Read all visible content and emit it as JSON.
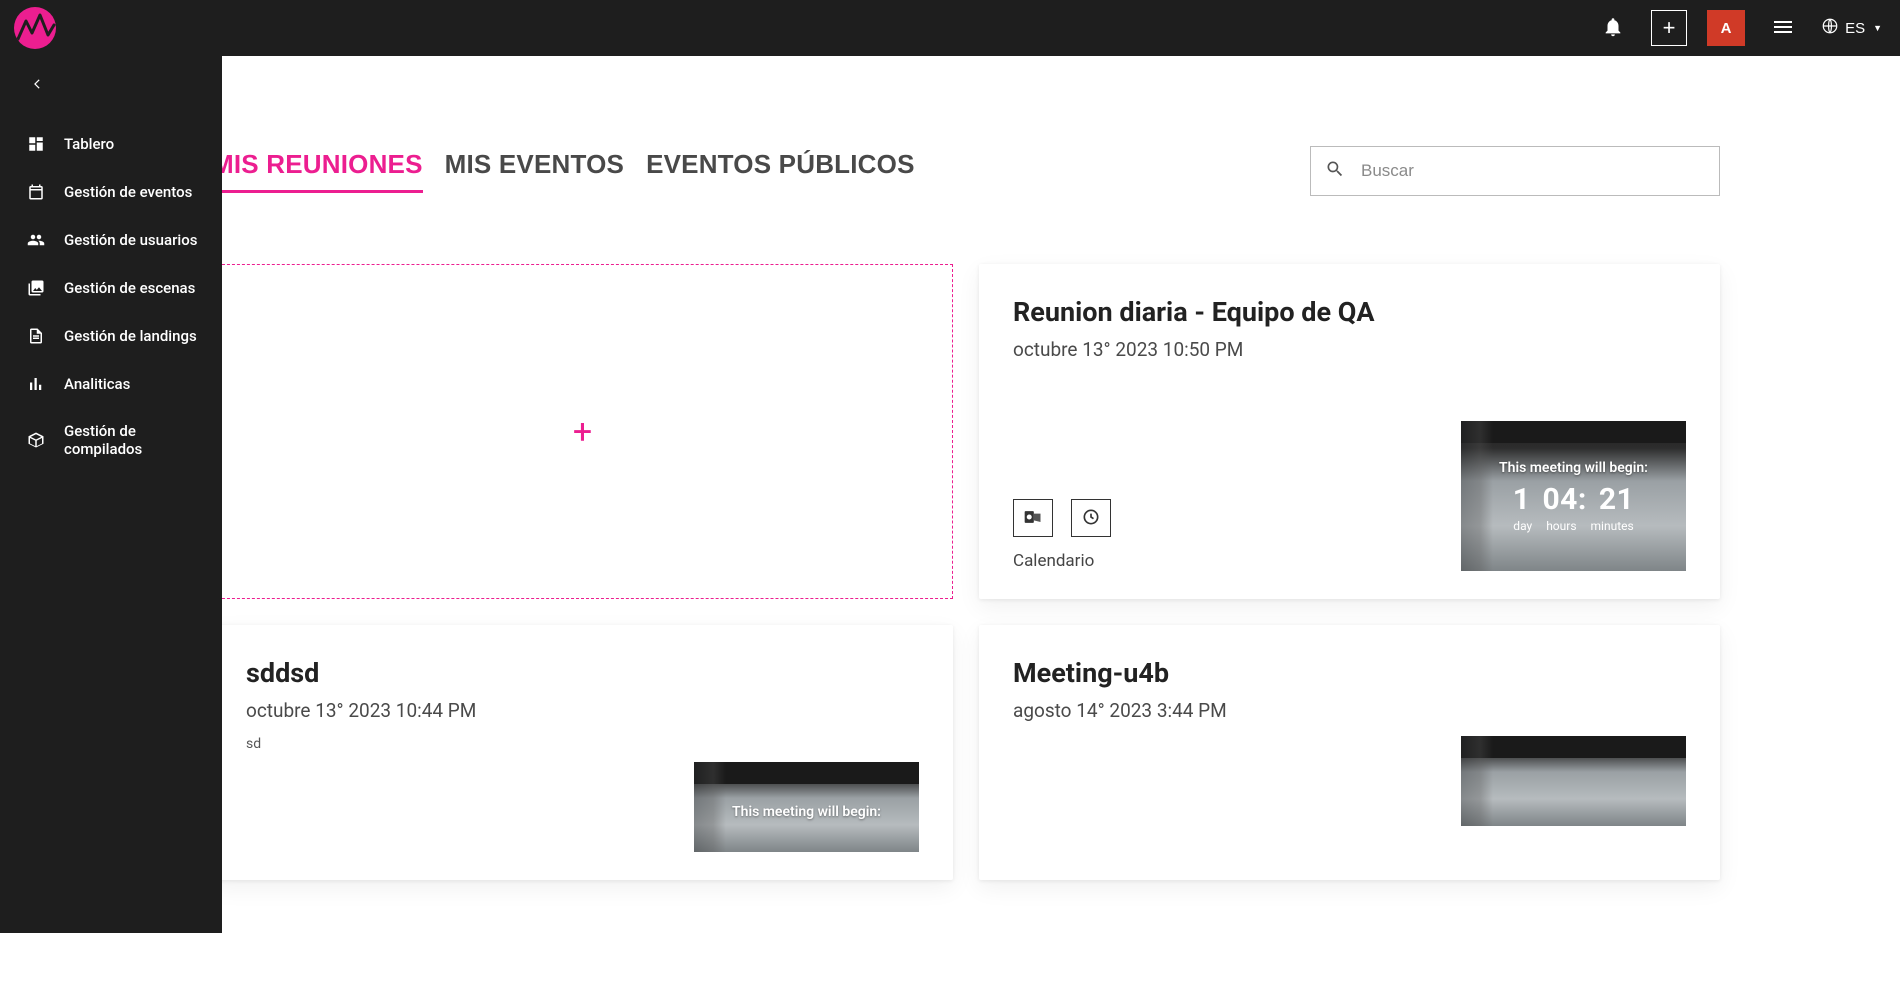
{
  "topbar": {
    "avatar_letter": "A",
    "language": "ES"
  },
  "sidebar": {
    "items": [
      {
        "label": "Tablero"
      },
      {
        "label": "Gestión de eventos"
      },
      {
        "label": "Gestión de usuarios"
      },
      {
        "label": "Gestión de escenas"
      },
      {
        "label": "Gestión de landings"
      },
      {
        "label": "Analiticas"
      },
      {
        "label": "Gestión de compilados"
      }
    ]
  },
  "tabs": {
    "my_meetings": "MIS REUNIONES",
    "my_events": "MIS EVENTOS",
    "public_events": "EVENTOS PÚBLICOS"
  },
  "search": {
    "placeholder": "Buscar"
  },
  "cards": {
    "calendario_label": "Calendario",
    "begin_label": "This meeting will begin:",
    "units": {
      "day": "day",
      "hours": "hours",
      "minutes": "minutes"
    },
    "meeting1": {
      "title": "Reunion diaria - Equipo de QA",
      "date": "octubre 13° 2023 10:50 PM",
      "countdown": {
        "d": "1",
        "h": "04:",
        "m": "21"
      }
    },
    "meeting2": {
      "title": "sddsd",
      "date": "octubre 13° 2023 10:44 PM",
      "desc": "sd"
    },
    "meeting3": {
      "title": "Meeting-u4b",
      "date": "agosto 14° 2023 3:44 PM"
    }
  }
}
